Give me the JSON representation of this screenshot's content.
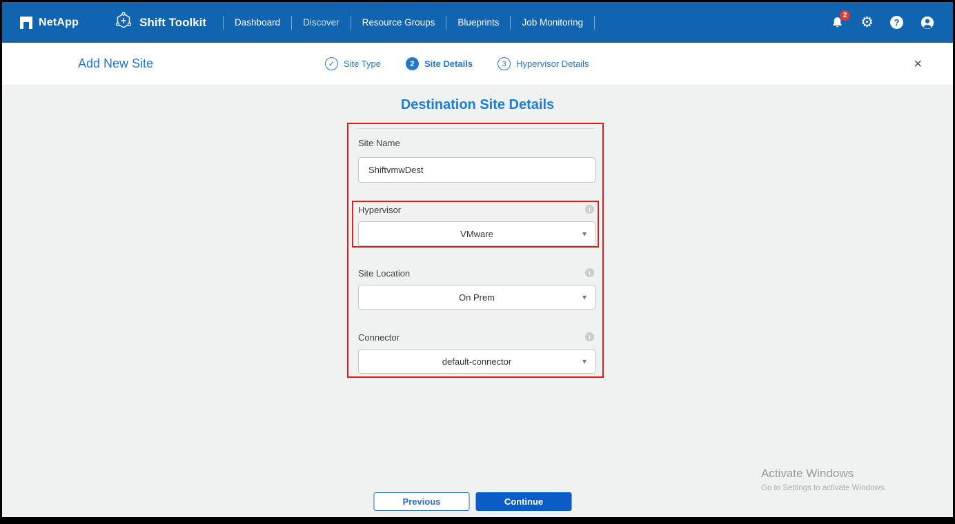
{
  "colors": {
    "navbar": "#1164af",
    "accent": "#2577c8",
    "title_blue": "#1c7ed6",
    "annotation_red": "#e21b1b",
    "continue_button": "#0b5cc4",
    "badge_red": "#e53935"
  },
  "navbar": {
    "brand": "NetApp",
    "app_name": "Shift Toolkit",
    "items": [
      {
        "label": "Dashboard"
      },
      {
        "label": "Discover"
      },
      {
        "label": "Resource Groups"
      },
      {
        "label": "Blueprints"
      },
      {
        "label": "Job Monitoring"
      }
    ],
    "notification_count": "2"
  },
  "header": {
    "title": "Add New Site",
    "steps": [
      {
        "label": "Site Type",
        "state": "done"
      },
      {
        "label": "Site Details",
        "state": "active",
        "number": "2"
      },
      {
        "label": "Hypervisor Details",
        "state": "todo",
        "number": "3"
      }
    ]
  },
  "form": {
    "title": "Destination Site Details",
    "site_name": {
      "label": "Site Name",
      "value": "ShiftvmwDest"
    },
    "hypervisor": {
      "label": "Hypervisor",
      "value": "VMware"
    },
    "site_location": {
      "label": "Site Location",
      "value": "On Prem"
    },
    "connector": {
      "label": "Connector",
      "value": "default-connector"
    }
  },
  "footer": {
    "previous_label": "Previous",
    "continue_label": "Continue"
  },
  "watermark": {
    "line1": "Activate Windows",
    "line2": "Go to Settings to activate Windows."
  },
  "icons": {
    "check": "✓",
    "caret": "▾",
    "info": "i",
    "gear": "⚙",
    "question": "?",
    "close": "✕"
  }
}
